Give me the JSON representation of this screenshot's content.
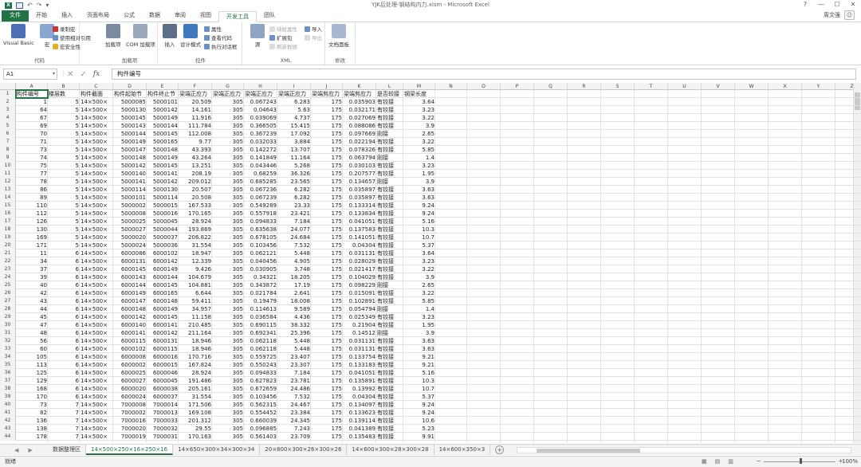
{
  "window": {
    "title": "YJK后处理-钢结构内力.xlsm - Microsoft Excel",
    "user": "周文强",
    "controls": [
      "?",
      "—",
      "☐",
      "✕"
    ]
  },
  "ribbon": {
    "tabs": [
      "文件",
      "开始",
      "插入",
      "页面布局",
      "公式",
      "数据",
      "审阅",
      "视图",
      "开发工具",
      "团队"
    ],
    "active_tab": "开发工具",
    "groups": {
      "code": {
        "title": "代码",
        "visual_basic": "Visual Basic",
        "macros": "宏",
        "record_macro": "录制宏",
        "relative_ref": "使用相对引用",
        "macro_security": "宏安全性"
      },
      "addins": {
        "title": "加载项",
        "addins": "加载项",
        "com_addins": "COM 加载项"
      },
      "controls": {
        "title": "控件",
        "insert": "插入",
        "design_mode": "设计模式",
        "properties": "属性",
        "view_code": "查看代码",
        "run_dialog": "执行对话框"
      },
      "xml": {
        "title": "XML",
        "source": "源",
        "map_props": "映射属性",
        "expansion": "扩展包",
        "refresh_data": "刷新数据",
        "import": "导入",
        "export": "导出"
      },
      "modify": {
        "title": "修改",
        "doc_panel": "文档面板"
      }
    }
  },
  "formula_bar": {
    "name_box": "A1",
    "content": "构件编号"
  },
  "grid": {
    "columns": [
      "A",
      "B",
      "C",
      "D",
      "E",
      "F",
      "G",
      "H",
      "I",
      "J",
      "K",
      "L",
      "M",
      "N",
      "O",
      "P",
      "Q",
      "R",
      "S",
      "T",
      "U",
      "V",
      "W",
      "X",
      "Y",
      "Z"
    ],
    "row_numbers": [
      "1",
      "2",
      "3",
      "4",
      "5",
      "6",
      "7",
      "8",
      "9",
      "10",
      "11",
      "12",
      "13",
      "14",
      "15",
      "16",
      "17",
      "18",
      "19",
      "20",
      "21",
      "22",
      "23",
      "24",
      "25",
      "26",
      "27",
      "28",
      "29",
      "30",
      "31",
      "32",
      "33",
      "34",
      "35",
      "36",
      "37",
      "38",
      "39",
      "40",
      "41",
      "42",
      "43",
      "44"
    ],
    "header": [
      "构件编号",
      "楼层数",
      "构件截面",
      "构件起始节",
      "构件终止节",
      "梁端正应力",
      "梁端正应力",
      "梁端正应力",
      "梁端正应力",
      "梁端剪应力",
      "梁端剪应力",
      "是否较接",
      "钢梁长度"
    ],
    "rows": [
      [
        "1",
        "5",
        "14×500×",
        "5000085",
        "5000101",
        "20.509",
        "305",
        "0.067243",
        "6.283",
        "175",
        "0.035903",
        "有铰接",
        "3.64"
      ],
      [
        "64",
        "5",
        "14×500×",
        "5000130",
        "5000142",
        "14.161",
        "305",
        "0.04643",
        "5.63",
        "175",
        "0.032171",
        "有铰接",
        "3.23"
      ],
      [
        "67",
        "5",
        "14×500×",
        "5000145",
        "5000149",
        "11.916",
        "305",
        "0.039069",
        "4.737",
        "175",
        "0.027069",
        "有铰接",
        "3.22"
      ],
      [
        "69",
        "5",
        "14×500×",
        "5000143",
        "5000144",
        "111.784",
        "305",
        "0.366505",
        "15.415",
        "175",
        "0.088086",
        "有铰接",
        "3.9"
      ],
      [
        "70",
        "5",
        "14×500×",
        "5000144",
        "5000145",
        "112.008",
        "305",
        "0.367239",
        "17.092",
        "175",
        "0.097669",
        "刚接",
        "2.65"
      ],
      [
        "71",
        "5",
        "14×500×",
        "5000149",
        "5000165",
        "9.77",
        "305",
        "0.032033",
        "3.884",
        "175",
        "0.022194",
        "有铰接",
        "3.22"
      ],
      [
        "73",
        "5",
        "14×500×",
        "5000147",
        "5000148",
        "43.393",
        "305",
        "0.142272",
        "13.707",
        "175",
        "0.078326",
        "有铰接",
        "5.85"
      ],
      [
        "74",
        "5",
        "14×500×",
        "5000148",
        "5000149",
        "43.264",
        "305",
        "0.141849",
        "11.164",
        "175",
        "0.063794",
        "刚接",
        "1.4"
      ],
      [
        "75",
        "5",
        "14×500×",
        "5000142",
        "5000145",
        "13.251",
        "305",
        "0.043446",
        "5.268",
        "175",
        "0.030103",
        "有铰接",
        "3.23"
      ],
      [
        "77",
        "5",
        "14×500×",
        "5000140",
        "5000141",
        "208.19",
        "305",
        "0.68259",
        "36.326",
        "175",
        "0.207577",
        "有铰接",
        "1.95"
      ],
      [
        "78",
        "5",
        "14×500×",
        "5000141",
        "5000142",
        "209.012",
        "305",
        "0.685285",
        "23.565",
        "175",
        "0.134657",
        "刚接",
        "3.9"
      ],
      [
        "86",
        "5",
        "14×500×",
        "5000114",
        "5000130",
        "20.507",
        "305",
        "0.067236",
        "6.282",
        "175",
        "0.035897",
        "有铰接",
        "3.63"
      ],
      [
        "89",
        "5",
        "14×500×",
        "5000101",
        "5000114",
        "20.508",
        "305",
        "0.067239",
        "6.282",
        "175",
        "0.035897",
        "有铰接",
        "3.63"
      ],
      [
        "110",
        "5",
        "14×500×",
        "5000002",
        "5000015",
        "167.533",
        "305",
        "0.549289",
        "23.33",
        "175",
        "0.133314",
        "有铰接",
        "9.24"
      ],
      [
        "112",
        "5",
        "14×500×",
        "5000008",
        "5000016",
        "170.165",
        "305",
        "0.557918",
        "23.421",
        "175",
        "0.133834",
        "有铰接",
        "9.24"
      ],
      [
        "126",
        "5",
        "14×500×",
        "5000025",
        "5000045",
        "28.924",
        "305",
        "0.094833",
        "7.184",
        "175",
        "0.041051",
        "有铰接",
        "5.16"
      ],
      [
        "130",
        "5",
        "14×500×",
        "5000027",
        "5000044",
        "193.869",
        "305",
        "0.635638",
        "24.077",
        "175",
        "0.137583",
        "有铰接",
        "10.3"
      ],
      [
        "169",
        "5",
        "14×500×",
        "5000020",
        "5000037",
        "206.822",
        "305",
        "0.678105",
        "24.684",
        "175",
        "0.141051",
        "有铰接",
        "10.7"
      ],
      [
        "171",
        "5",
        "14×500×",
        "5000024",
        "5000036",
        "31.554",
        "305",
        "0.103456",
        "7.532",
        "175",
        "0.04304",
        "有铰接",
        "5.37"
      ],
      [
        "11",
        "6",
        "14×500×",
        "6000086",
        "6000102",
        "18.947",
        "305",
        "0.062121",
        "5.448",
        "175",
        "0.031131",
        "有铰接",
        "3.64"
      ],
      [
        "34",
        "6",
        "14×500×",
        "6000131",
        "6000142",
        "12.339",
        "305",
        "0.040456",
        "4.905",
        "175",
        "0.028029",
        "有铰接",
        "3.23"
      ],
      [
        "37",
        "6",
        "14×500×",
        "6000145",
        "6000149",
        "9.426",
        "305",
        "0.030905",
        "3.748",
        "175",
        "0.021417",
        "有铰接",
        "3.22"
      ],
      [
        "39",
        "6",
        "14×500×",
        "6000143",
        "6000144",
        "104.679",
        "305",
        "0.34321",
        "18.205",
        "175",
        "0.104029",
        "有铰接",
        "3.9"
      ],
      [
        "40",
        "6",
        "14×500×",
        "6000144",
        "6000145",
        "104.881",
        "305",
        "0.343872",
        "17.19",
        "175",
        "0.098229",
        "刚接",
        "2.65"
      ],
      [
        "42",
        "6",
        "14×500×",
        "6000149",
        "6000165",
        "6.644",
        "305",
        "0.021784",
        "2.641",
        "175",
        "0.015091",
        "有铰接",
        "3.22"
      ],
      [
        "43",
        "6",
        "14×500×",
        "6000147",
        "6000148",
        "59.411",
        "305",
        "0.19479",
        "18.008",
        "175",
        "0.102891",
        "有铰接",
        "5.85"
      ],
      [
        "44",
        "6",
        "14×500×",
        "6000148",
        "6000149",
        "34.957",
        "305",
        "0.114613",
        "9.589",
        "175",
        "0.054794",
        "刚接",
        "1.4"
      ],
      [
        "45",
        "6",
        "14×500×",
        "6000142",
        "6000145",
        "11.158",
        "305",
        "0.036584",
        "4.436",
        "175",
        "0.025349",
        "有铰接",
        "3.23"
      ],
      [
        "47",
        "6",
        "14×500×",
        "6000140",
        "6000141",
        "210.485",
        "305",
        "0.690115",
        "38.332",
        "175",
        "0.21904",
        "有铰接",
        "1.95"
      ],
      [
        "48",
        "6",
        "14×500×",
        "6000141",
        "6000142",
        "211.164",
        "305",
        "0.692341",
        "25.396",
        "175",
        "0.14512",
        "刚接",
        "3.9"
      ],
      [
        "56",
        "6",
        "14×500×",
        "6000115",
        "6000131",
        "18.946",
        "305",
        "0.062118",
        "5.448",
        "175",
        "0.031131",
        "有铰接",
        "3.63"
      ],
      [
        "60",
        "6",
        "14×500×",
        "6000102",
        "6000115",
        "18.946",
        "305",
        "0.062118",
        "5.448",
        "175",
        "0.031131",
        "有铰接",
        "3.63"
      ],
      [
        "105",
        "6",
        "14×500×",
        "6000008",
        "6000016",
        "170.716",
        "305",
        "0.559725",
        "23.407",
        "175",
        "0.133754",
        "有铰接",
        "9.21"
      ],
      [
        "113",
        "6",
        "14×500×",
        "6000002",
        "6000015",
        "167.824",
        "305",
        "0.550243",
        "23.307",
        "175",
        "0.133183",
        "有铰接",
        "9.21"
      ],
      [
        "125",
        "6",
        "14×500×",
        "6000025",
        "6000046",
        "28.924",
        "305",
        "0.094833",
        "7.184",
        "175",
        "0.041051",
        "有铰接",
        "5.16"
      ],
      [
        "129",
        "6",
        "14×500×",
        "6000027",
        "6000045",
        "191.486",
        "305",
        "0.627823",
        "23.781",
        "175",
        "0.135891",
        "有铰接",
        "10.3"
      ],
      [
        "168",
        "6",
        "14×500×",
        "6000020",
        "6000038",
        "205.161",
        "305",
        "0.672659",
        "24.486",
        "175",
        "0.13992",
        "有铰接",
        "10.7"
      ],
      [
        "170",
        "6",
        "14×500×",
        "6000024",
        "6000037",
        "31.554",
        "305",
        "0.103456",
        "7.532",
        "175",
        "0.04304",
        "有铰接",
        "5.37"
      ],
      [
        "73",
        "7",
        "14×500×",
        "7000008",
        "7000014",
        "171.506",
        "305",
        "0.562315",
        "24.467",
        "175",
        "0.134097",
        "有铰接",
        "9.24"
      ],
      [
        "82",
        "7",
        "14×500×",
        "7000002",
        "7000013",
        "169.108",
        "305",
        "0.554452",
        "23.384",
        "175",
        "0.133623",
        "有铰接",
        "9.24"
      ],
      [
        "136",
        "7",
        "14×500×",
        "7000016",
        "7000033",
        "201.312",
        "305",
        "0.660039",
        "24.345",
        "175",
        "0.139114",
        "有铰接",
        "10.6"
      ],
      [
        "138",
        "7",
        "14×500×",
        "7000020",
        "7000032",
        "29.55",
        "305",
        "0.096885",
        "7.243",
        "175",
        "0.041389",
        "有铰接",
        "5.23"
      ],
      [
        "178",
        "7",
        "14×500×",
        "7000019",
        "7000031",
        "170.163",
        "305",
        "0.561403",
        "23.709",
        "175",
        "0.135483",
        "有铰接",
        "9.91"
      ]
    ]
  },
  "sheets": {
    "tabs": [
      "数据整理区",
      "14×500×250×16×250×16",
      "14×650×300×34×300×34",
      "20×800×300×26×300×26",
      "14×600×300×28×300×28",
      "14×600×350×3"
    ],
    "active_index": 1
  },
  "status": {
    "ready": "就绪",
    "zoom": "100%"
  },
  "colors": {
    "excel_green": "#217346",
    "grid_line": "#e1e1e1",
    "header_bg": "#f3f3f3"
  }
}
